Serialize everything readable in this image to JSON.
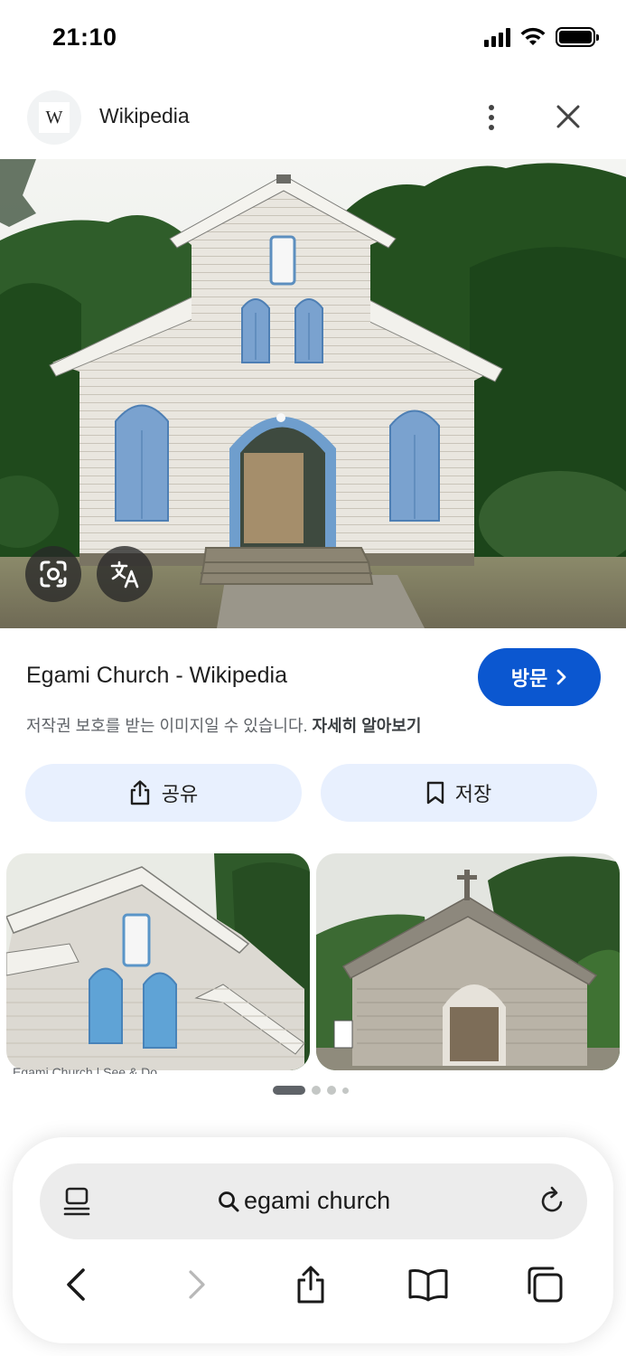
{
  "status_bar": {
    "time": "21:10"
  },
  "header": {
    "site_name": "Wikipedia",
    "logo_letter": "W"
  },
  "result": {
    "title": "Egami Church - Wikipedia",
    "visit_label": "방문",
    "copyright_text": "저작권 보호를 받는 이미지일 수 있습니다.",
    "learn_more": "자세히 알아보기",
    "share_label": "공유",
    "save_label": "저장"
  },
  "related": {
    "caption": "Egami Church | See & Do"
  },
  "pager": {
    "pages": 4,
    "current": 1
  },
  "url_bar": {
    "query": "egami church"
  },
  "colors": {
    "visit_button": "#0b57d0",
    "action_button_bg": "#e8f0fe",
    "url_bar_bg": "#ececec"
  },
  "icons": {
    "status": [
      "cellular-signal-icon",
      "wifi-icon",
      "battery-icon"
    ],
    "header": [
      "more-vert-icon",
      "close-icon"
    ],
    "overlay": [
      "lens-icon",
      "translate-icon"
    ],
    "toolbar": [
      "reader-icon",
      "search-icon",
      "reload-icon",
      "back-icon",
      "forward-icon",
      "share-icon",
      "bookmarks-icon",
      "tabs-icon"
    ]
  }
}
